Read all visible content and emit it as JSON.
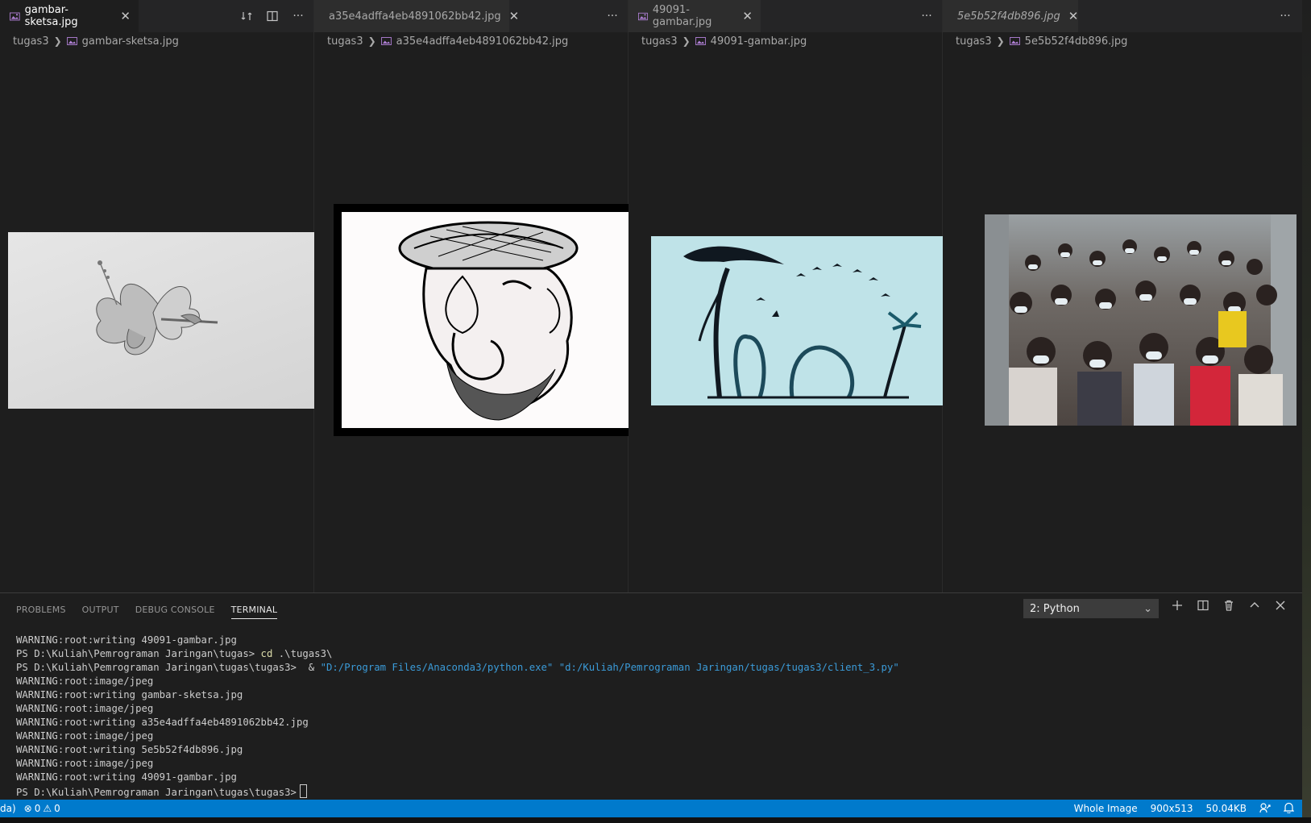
{
  "groups": [
    {
      "tab": "gambar-sketsa.jpg",
      "italic": false,
      "active": true,
      "crumbs": [
        "tugas3",
        "gambar-sketsa.jpg"
      ]
    },
    {
      "tab": "a35e4adffa4eb4891062bb42.jpg",
      "italic": false,
      "active": false,
      "crumbs": [
        "tugas3",
        "a35e4adffa4eb4891062bb42.jpg"
      ]
    },
    {
      "tab": "49091-gambar.jpg",
      "italic": false,
      "active": false,
      "crumbs": [
        "tugas3",
        "49091-gambar.jpg"
      ]
    },
    {
      "tab": "5e5b52f4db896.jpg",
      "italic": true,
      "active": false,
      "crumbs": [
        "tugas3",
        "5e5b52f4db896.jpg"
      ]
    }
  ],
  "panel": {
    "tabs": [
      "PROBLEMS",
      "OUTPUT",
      "DEBUG CONSOLE",
      "TERMINAL"
    ],
    "active_tab": "TERMINAL",
    "terminal_select": "2: Python"
  },
  "terminal": {
    "l1": "WARNING:root:writing 49091-gambar.jpg",
    "l2_prompt": "PS D:\\Kuliah\\Pemrograman Jaringan\\tugas> ",
    "l2_cmd": "cd",
    "l2_arg": " .\\tugas3\\",
    "l3_prompt": "PS D:\\Kuliah\\Pemrograman Jaringan\\tugas\\tugas3> ",
    "l3_amp": " & ",
    "l3_exe": "\"D:/Program Files/Anaconda3/python.exe\"",
    "l3_space": " ",
    "l3_script": "\"d:/Kuliah/Pemrograman Jaringan/tugas/tugas3/client_3.py\"",
    "l4": "WARNING:root:image/jpeg",
    "l5": "WARNING:root:writing gambar-sketsa.jpg",
    "l6": "WARNING:root:image/jpeg",
    "l7": "WARNING:root:writing a35e4adffa4eb4891062bb42.jpg",
    "l8": "WARNING:root:image/jpeg",
    "l9": "WARNING:root:writing 5e5b52f4db896.jpg",
    "l10": "WARNING:root:image/jpeg",
    "l11": "WARNING:root:writing 49091-gambar.jpg",
    "l12_prompt": "PS D:\\Kuliah\\Pemrograman Jaringan\\tugas\\tugas3>"
  },
  "status": {
    "left_text": "da)",
    "errors": "0",
    "warnings": "0",
    "mode": "Whole Image",
    "dimensions": "900x513",
    "size": "50.04KB"
  },
  "colors": {
    "statusbar": "#007acc",
    "editor_bg": "#1e1e1e",
    "image_icon": "#b180d7",
    "terminal_command": "#dcdcaa",
    "terminal_string": "#3b9bd8"
  }
}
